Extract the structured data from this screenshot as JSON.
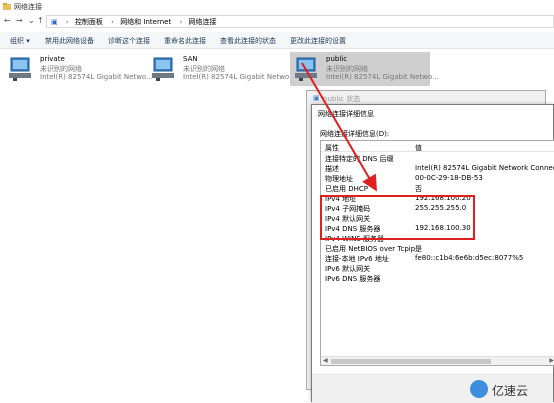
{
  "window": {
    "title": "网络连接"
  },
  "address": {
    "crumbs": [
      "控制面板",
      "网络和 Internet",
      "网络连接"
    ]
  },
  "toolbar": {
    "items": [
      "组织 ▾",
      "禁用此网络设备",
      "诊断这个连接",
      "重命名此连接",
      "查看此连接的状态",
      "更改此连接的设置"
    ]
  },
  "adapters": [
    {
      "name": "private",
      "status": "未识别的网络",
      "device": "Intel(R) 82574L Gigabit Netwo..."
    },
    {
      "name": "SAN",
      "status": "未识别的网络",
      "device": "Intel(R) 82574L Gigabit Netwo..."
    },
    {
      "name": "public",
      "status": "未识别的网络",
      "device": "Intel(R) 82574L Gigabit Netwo..."
    }
  ],
  "status_window": {
    "title": "public 状态"
  },
  "details": {
    "title": "网络连接详细信息",
    "label": "网络连接详细信息(D):",
    "col_property": "属性",
    "col_value": "值",
    "rows": [
      {
        "p": "连接特定的 DNS 后缀",
        "v": ""
      },
      {
        "p": "描述",
        "v": "Intel(R) 82574L Gigabit Network Connect"
      },
      {
        "p": "物理地址",
        "v": "00-0C-29-18-DB-53"
      },
      {
        "p": "已启用 DHCP",
        "v": "否"
      },
      {
        "p": "IPv4 地址",
        "v": "192.168.100.20"
      },
      {
        "p": "IPv4 子网掩码",
        "v": "255.255.255.0"
      },
      {
        "p": "IPv4 默认网关",
        "v": ""
      },
      {
        "p": "IPv4 DNS 服务器",
        "v": "192.168.100.30"
      },
      {
        "p": "IPv4 WINS 服务器",
        "v": ""
      },
      {
        "p": "已启用 NetBIOS over Tcpip",
        "v": "是"
      },
      {
        "p": "连接-本地 IPv6 地址",
        "v": "fe80::c1b4:6e6b:d5ec:8077%5"
      },
      {
        "p": "IPv6 默认网关",
        "v": ""
      },
      {
        "p": "IPv6 DNS 服务器",
        "v": ""
      }
    ]
  },
  "watermark": {
    "text": "亿速云"
  },
  "colors": {
    "highlight": "#e02020",
    "selection": "#cfcfcf",
    "toolbar_text": "#1e395b"
  },
  "icons": [
    "network-folder-icon",
    "refresh-icon",
    "network-adapter-icon",
    "status-icon",
    "watermark-logo-icon"
  ]
}
